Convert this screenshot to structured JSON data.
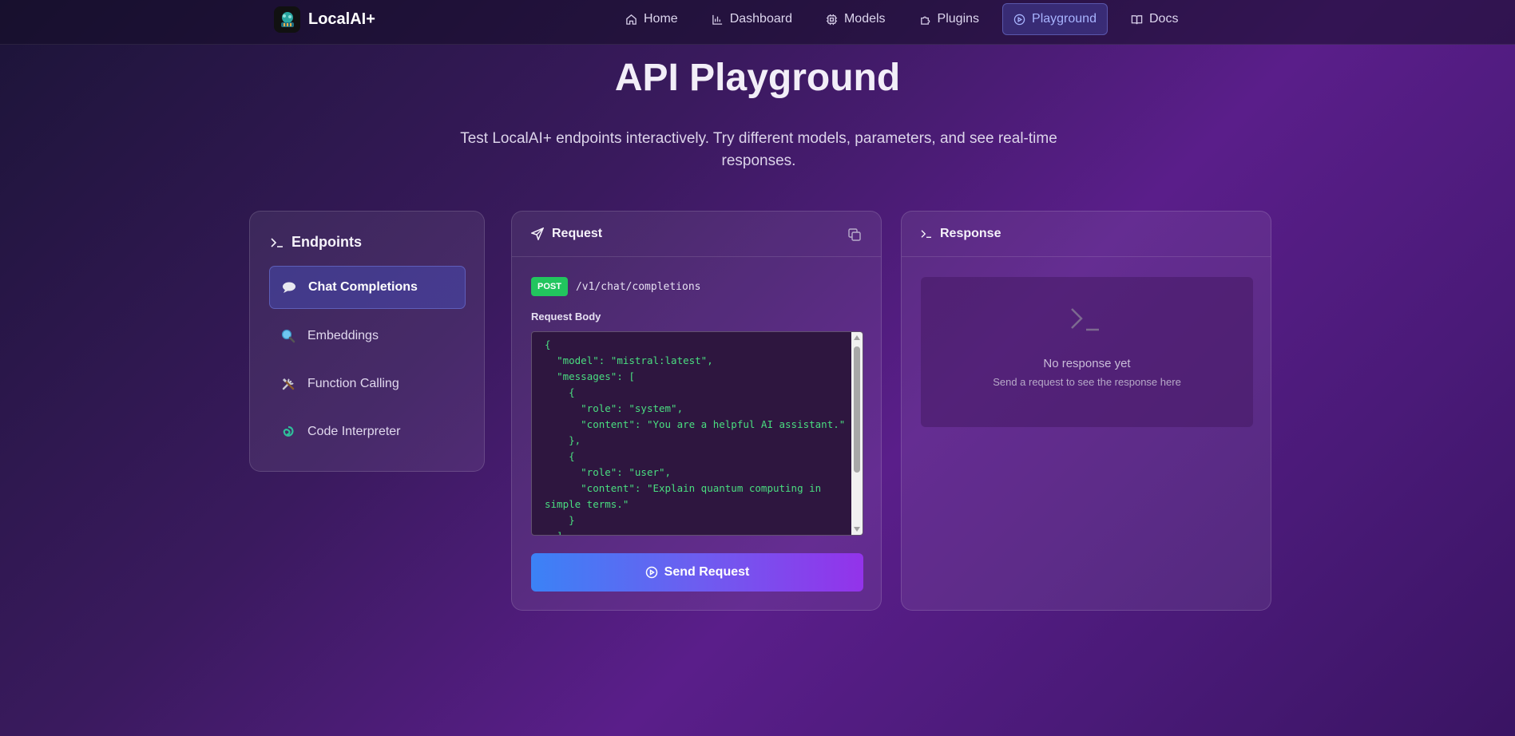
{
  "brand": {
    "name": "LocalAI+"
  },
  "nav": {
    "items": [
      {
        "label": "Home",
        "icon": "home-icon"
      },
      {
        "label": "Dashboard",
        "icon": "bar-chart-icon"
      },
      {
        "label": "Models",
        "icon": "cpu-icon"
      },
      {
        "label": "Plugins",
        "icon": "puzzle-icon"
      },
      {
        "label": "Playground",
        "icon": "play-circle-icon",
        "active": true
      },
      {
        "label": "Docs",
        "icon": "book-icon"
      }
    ]
  },
  "hero": {
    "title": "API Playground",
    "subtitle": "Test LocalAI+ endpoints interactively. Try different models, parameters, and see real-time responses."
  },
  "endpoints": {
    "title": "Endpoints",
    "items": [
      {
        "label": "Chat Completions",
        "icon": "speech-bubble-icon",
        "active": true
      },
      {
        "label": "Embeddings",
        "icon": "magnifier-icon"
      },
      {
        "label": "Function Calling",
        "icon": "tools-icon"
      },
      {
        "label": "Code Interpreter",
        "icon": "loop-icon"
      }
    ]
  },
  "request": {
    "title": "Request",
    "method": "POST",
    "path": "/v1/chat/completions",
    "body_label": "Request Body",
    "body": "{\n  \"model\": \"mistral:latest\",\n  \"messages\": [\n    {\n      \"role\": \"system\",\n      \"content\": \"You are a helpful AI assistant.\"\n    },\n    {\n      \"role\": \"user\",\n      \"content\": \"Explain quantum computing in simple terms.\"\n    }\n  ]\n}",
    "send_label": "Send Request"
  },
  "response": {
    "title": "Response",
    "empty_title": "No response yet",
    "empty_sub": "Send a request to see the response here"
  },
  "colors": {
    "accent": "#6d5df0",
    "method_post": "#22c55e",
    "code_text": "#4ade80"
  }
}
